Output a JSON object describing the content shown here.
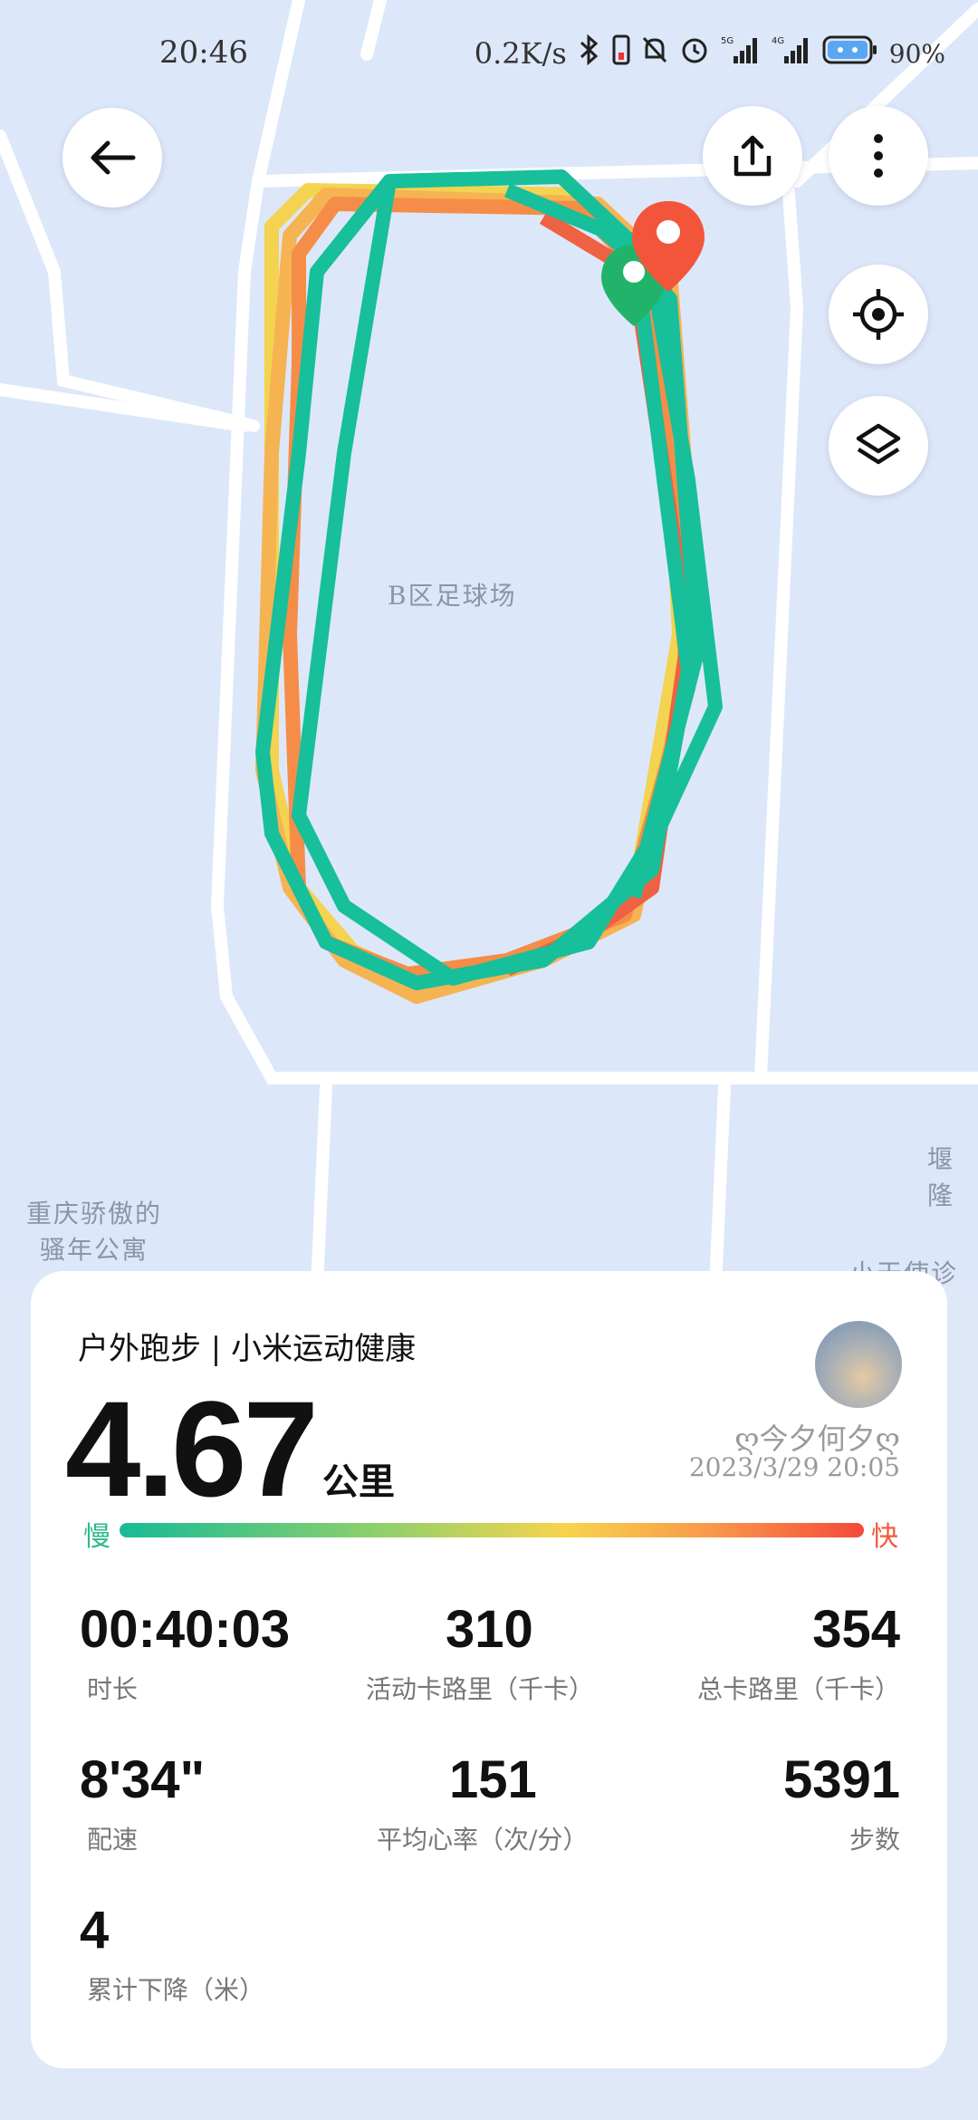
{
  "status_bar": {
    "time": "20:46",
    "speed": "0.2K/s",
    "battery": "90%",
    "icons": [
      "bluetooth-icon",
      "phone-icon",
      "mute-icon",
      "alarm-icon",
      "signal-5g-icon",
      "signal-4g-icon",
      "battery-icon"
    ]
  },
  "map": {
    "labels": {
      "field": "B区足球场",
      "apartment_line1": "重庆骄傲的",
      "apartment_line2": "骚年公寓",
      "right_label": "堰隆",
      "bottom_right": "小天使诊所"
    },
    "buttons": [
      "back-icon",
      "share-icon",
      "more-icon",
      "locate-icon",
      "layers-icon"
    ]
  },
  "card": {
    "title": "户外跑步 | 小米运动健康",
    "distance": "4.67",
    "distance_unit": "公里",
    "user_name": "ღ今夕何夕ღ",
    "date": "2023/3/29  20:05",
    "slow_label": "慢",
    "fast_label": "快",
    "stats": [
      {
        "value": "00:40:03",
        "label": "时长"
      },
      {
        "value": "310",
        "label": "活动卡路里（千卡）"
      },
      {
        "value": "354",
        "label": "总卡路里（千卡）"
      },
      {
        "value": "8'34\"",
        "label": "配速"
      },
      {
        "value": "151",
        "label": "平均心率（次/分）"
      },
      {
        "value": "5391",
        "label": "步数"
      },
      {
        "value": "4",
        "label": "累计下降（米）"
      }
    ]
  },
  "colors": {
    "slow": "#17bb96",
    "fast": "#f44a3a",
    "route_main": "#1bbf9a"
  }
}
